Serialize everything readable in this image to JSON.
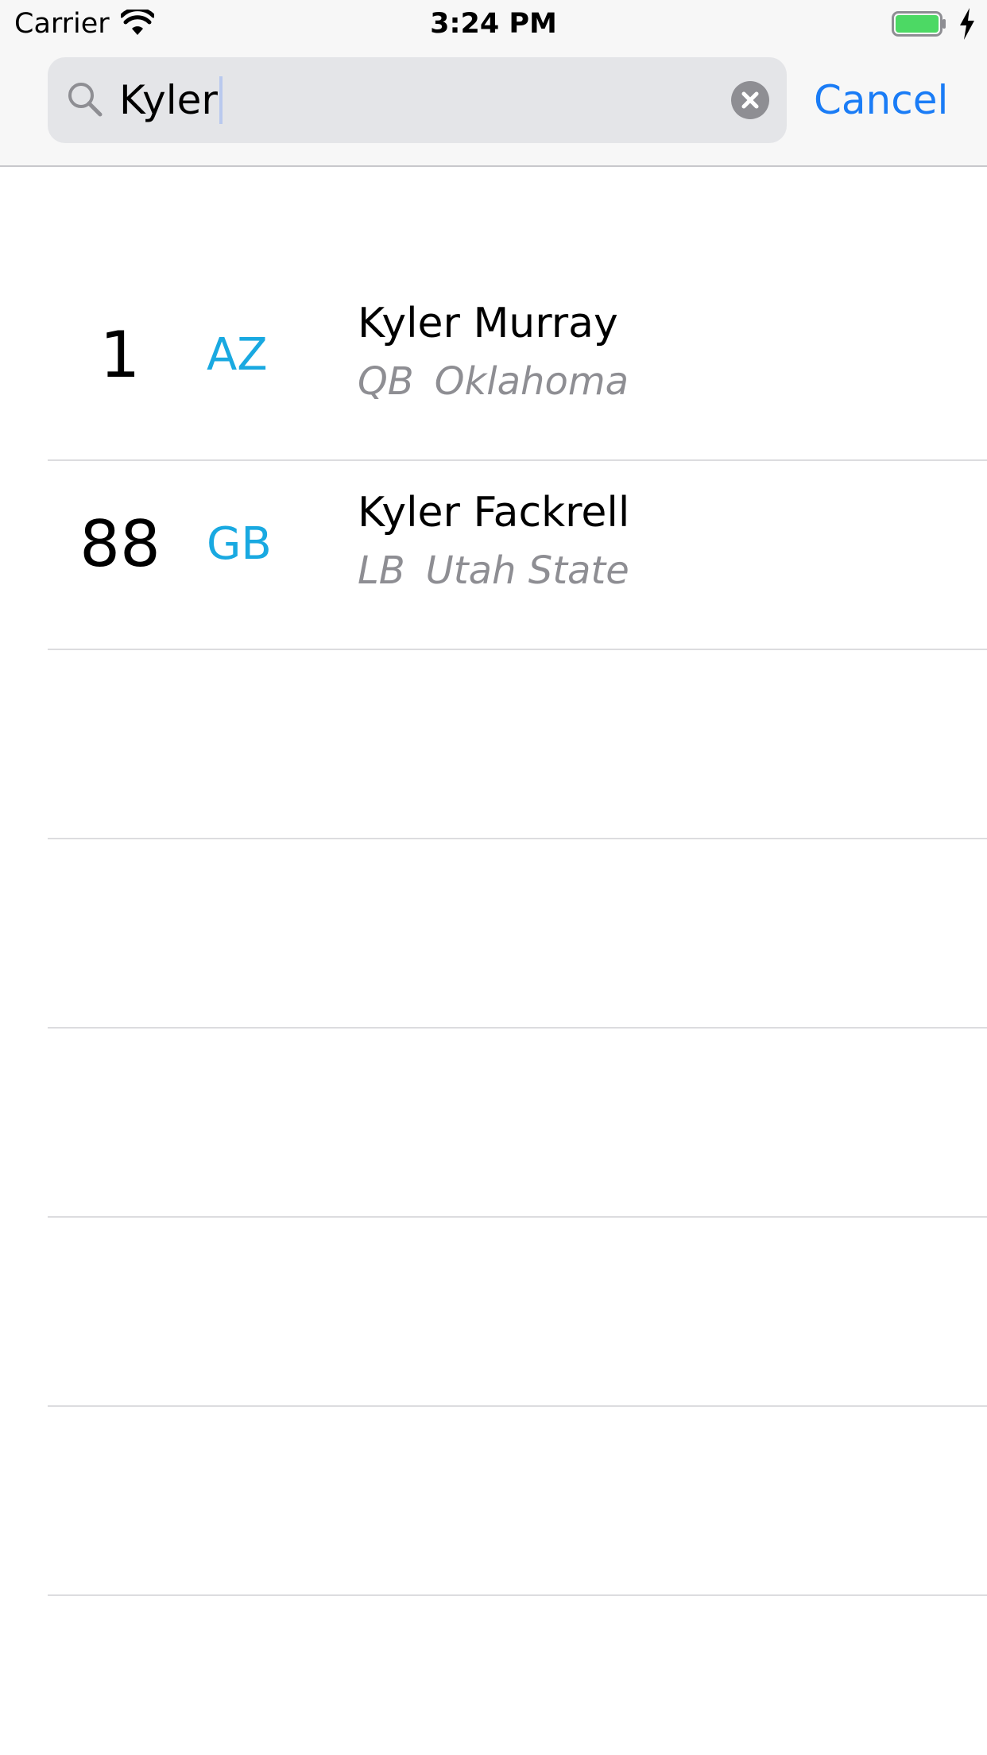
{
  "status_bar": {
    "carrier": "Carrier",
    "time": "3:24 PM",
    "battery_color": "#4cd964"
  },
  "search": {
    "value": "Kyler",
    "cancel_label": "Cancel",
    "accent_color": "#1a7cf6"
  },
  "results": [
    {
      "number": "1",
      "team": "AZ",
      "name": "Kyler Murray",
      "position": "QB",
      "school": "Oklahoma"
    },
    {
      "number": "88",
      "team": "GB",
      "name": "Kyler Fackrell",
      "position": "LB",
      "school": "Utah State"
    }
  ],
  "empty_row_count": 5,
  "team_color": "#19a9e1"
}
